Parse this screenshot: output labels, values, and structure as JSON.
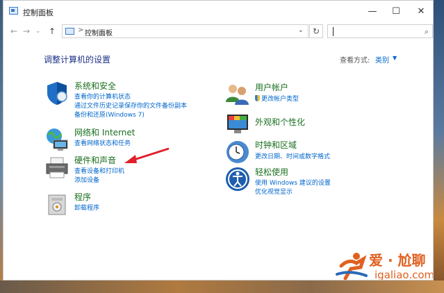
{
  "window": {
    "title": "控制面板",
    "minimize": "—",
    "maximize": "☐",
    "close": "✕"
  },
  "address": {
    "back": "←",
    "forward": "→",
    "dropdown": "⌄",
    "up": "↑",
    "separator": ">",
    "path": "控制面板",
    "addr_dropdown": "⌄",
    "refresh": "↻"
  },
  "search": {
    "placeholder": "",
    "value": "",
    "icon": "⌕"
  },
  "content": {
    "heading": "调整计算机的设置",
    "view_by_label": "查看方式:",
    "view_by_value": "类别",
    "view_by_arrow": "▼"
  },
  "categories_left": [
    {
      "title": "系统和安全",
      "icon": "shield-icon",
      "links": [
        "查看你的计算机状态",
        "通过文件历史记录保存你的文件备份副本",
        "备份和还原(Windows 7)"
      ]
    },
    {
      "title": "网络和 Internet",
      "icon": "network-icon",
      "links": [
        "查看网络状态和任务"
      ]
    },
    {
      "title": "硬件和声音",
      "icon": "printer-icon",
      "links": [
        "查看设备和打印机",
        "添加设备"
      ]
    },
    {
      "title": "程序",
      "icon": "programs-icon",
      "links": [
        "卸载程序"
      ]
    }
  ],
  "categories_right": [
    {
      "title": "用户帐户",
      "icon": "users-icon",
      "links": [
        "更改帐户类型"
      ]
    },
    {
      "title": "外观和个性化",
      "icon": "appearance-icon",
      "links": []
    },
    {
      "title": "时钟和区域",
      "icon": "clock-icon",
      "links": [
        "更改日期、时间或数字格式"
      ]
    },
    {
      "title": "轻松使用",
      "icon": "accessibility-icon",
      "links": [
        "使用 Windows 建议的设置",
        "优化视觉显示"
      ]
    }
  ],
  "watermark": {
    "cn": "爱 · 尬聊",
    "en": "igaliao.com"
  },
  "colors": {
    "heading": "#1e3287",
    "category_title": "#1a6f1f",
    "link": "#0066cc",
    "annotation_arrow": "#e0202a"
  }
}
